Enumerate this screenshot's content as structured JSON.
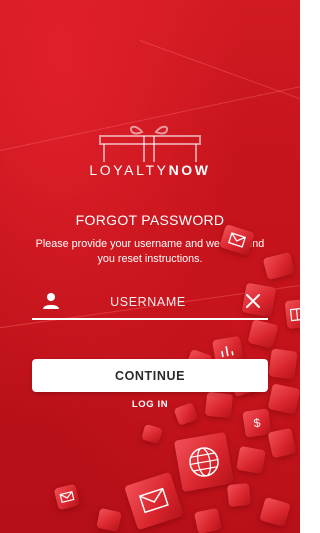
{
  "brand": {
    "logo_part1": "LOYALTY",
    "logo_part2": "NOW",
    "logo_icon": "gift-box-icon"
  },
  "page": {
    "title": "FORGOT PASSWORD",
    "instructions": "Please provide your username and we will send you reset instructions."
  },
  "form": {
    "username_placeholder": "USERNAME",
    "username_value": "",
    "user_icon": "user-icon",
    "clear_icon": "close-icon",
    "continue_label": "CONTINUE",
    "login_label": "LOG IN"
  },
  "colors": {
    "background": "#c8141c",
    "accent": "#ffffff",
    "button_text": "#2a2a2a"
  },
  "decor_icons": [
    "email-icon",
    "globe-icon",
    "gift-icon",
    "chart-icon",
    "dollar-icon",
    "cart-icon",
    "phone-icon"
  ]
}
